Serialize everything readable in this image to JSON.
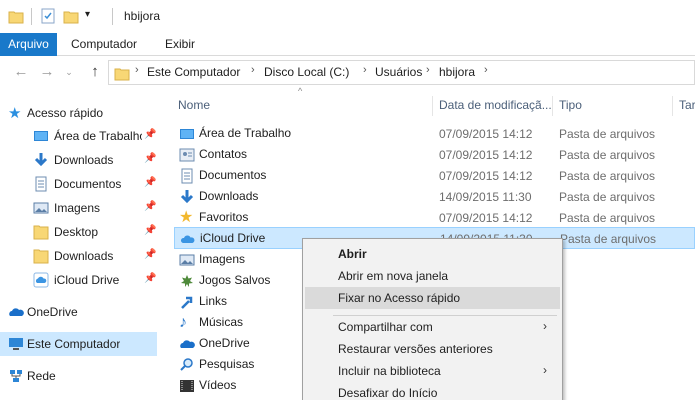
{
  "window": {
    "title": "hbijora"
  },
  "ribbon": {
    "tabs": [
      "Arquivo",
      "Computador",
      "Exibir"
    ]
  },
  "address": {
    "crumbs": [
      "Este Computador",
      "Disco Local (C:)",
      "Usuários",
      "hbijora"
    ]
  },
  "sidebar": {
    "quick_access": "Acesso rápido",
    "items": [
      {
        "label": "Área de Trabalho",
        "icon": "desktop-icon"
      },
      {
        "label": "Downloads",
        "icon": "download-icon"
      },
      {
        "label": "Documentos",
        "icon": "document-icon"
      },
      {
        "label": "Imagens",
        "icon": "image-icon"
      },
      {
        "label": "Desktop",
        "icon": "folder-icon"
      },
      {
        "label": "Downloads",
        "icon": "folder-icon"
      },
      {
        "label": "iCloud Drive",
        "icon": "icloud-icon"
      }
    ],
    "onedrive": "OneDrive",
    "this_pc": "Este Computador",
    "network": "Rede"
  },
  "columns": {
    "name": "Nome",
    "date": "Data de modificaçã...",
    "type": "Tipo",
    "size": "Tar"
  },
  "files": [
    {
      "name": "Área de Trabalho",
      "date": "07/09/2015 14:12",
      "type": "Pasta de arquivos",
      "icon": "desktop-icon"
    },
    {
      "name": "Contatos",
      "date": "07/09/2015 14:12",
      "type": "Pasta de arquivos",
      "icon": "contacts-icon"
    },
    {
      "name": "Documentos",
      "date": "07/09/2015 14:12",
      "type": "Pasta de arquivos",
      "icon": "document-icon"
    },
    {
      "name": "Downloads",
      "date": "14/09/2015 11:30",
      "type": "Pasta de arquivos",
      "icon": "download-icon"
    },
    {
      "name": "Favoritos",
      "date": "07/09/2015 14:12",
      "type": "Pasta de arquivos",
      "icon": "star-icon"
    },
    {
      "name": "iCloud Drive",
      "date": "14/09/2015 11:30",
      "type": "Pasta de arquivos",
      "icon": "icloud-icon"
    },
    {
      "name": "Imagens",
      "date": "",
      "type": "",
      "icon": "image-icon"
    },
    {
      "name": "Jogos Salvos",
      "date": "",
      "type": "",
      "icon": "games-icon"
    },
    {
      "name": "Links",
      "date": "",
      "type": "",
      "icon": "link-icon"
    },
    {
      "name": "Músicas",
      "date": "",
      "type": "",
      "icon": "music-icon"
    },
    {
      "name": "OneDrive",
      "date": "",
      "type": "",
      "icon": "onedrive-icon"
    },
    {
      "name": "Pesquisas",
      "date": "",
      "type": "",
      "icon": "search-icon"
    },
    {
      "name": "Vídeos",
      "date": "",
      "type": "",
      "icon": "video-icon"
    }
  ],
  "context_menu": [
    {
      "label": "Abrir",
      "bold": true
    },
    {
      "label": "Abrir em nova janela"
    },
    {
      "label": "Fixar no Acesso rápido",
      "highlighted": true
    },
    {
      "label": "Compartilhar com",
      "submenu": true
    },
    {
      "label": "Restaurar versões anteriores"
    },
    {
      "label": "Incluir na biblioteca",
      "submenu": true
    },
    {
      "label": "Desafixar do Início"
    }
  ],
  "colors": {
    "accent": "#1979ca",
    "selection": "#cce8ff",
    "folder": "#f8d775"
  }
}
